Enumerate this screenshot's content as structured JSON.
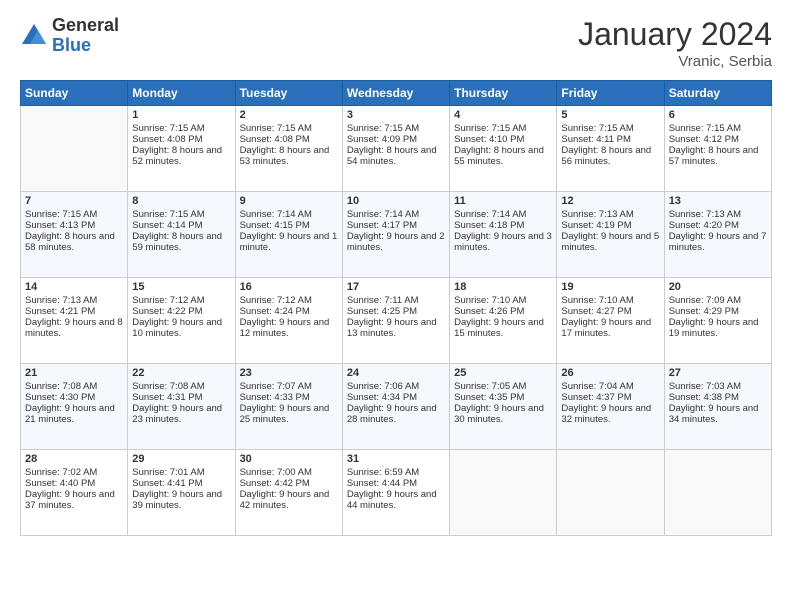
{
  "logo": {
    "general": "General",
    "blue": "Blue"
  },
  "title": "January 2024",
  "location": "Vranic, Serbia",
  "days_header": [
    "Sunday",
    "Monday",
    "Tuesday",
    "Wednesday",
    "Thursday",
    "Friday",
    "Saturday"
  ],
  "weeks": [
    [
      {
        "day": "",
        "sunrise": "",
        "sunset": "",
        "daylight": ""
      },
      {
        "day": "1",
        "sunrise": "Sunrise: 7:15 AM",
        "sunset": "Sunset: 4:08 PM",
        "daylight": "Daylight: 8 hours and 52 minutes."
      },
      {
        "day": "2",
        "sunrise": "Sunrise: 7:15 AM",
        "sunset": "Sunset: 4:08 PM",
        "daylight": "Daylight: 8 hours and 53 minutes."
      },
      {
        "day": "3",
        "sunrise": "Sunrise: 7:15 AM",
        "sunset": "Sunset: 4:09 PM",
        "daylight": "Daylight: 8 hours and 54 minutes."
      },
      {
        "day": "4",
        "sunrise": "Sunrise: 7:15 AM",
        "sunset": "Sunset: 4:10 PM",
        "daylight": "Daylight: 8 hours and 55 minutes."
      },
      {
        "day": "5",
        "sunrise": "Sunrise: 7:15 AM",
        "sunset": "Sunset: 4:11 PM",
        "daylight": "Daylight: 8 hours and 56 minutes."
      },
      {
        "day": "6",
        "sunrise": "Sunrise: 7:15 AM",
        "sunset": "Sunset: 4:12 PM",
        "daylight": "Daylight: 8 hours and 57 minutes."
      }
    ],
    [
      {
        "day": "7",
        "sunrise": "Sunrise: 7:15 AM",
        "sunset": "Sunset: 4:13 PM",
        "daylight": "Daylight: 8 hours and 58 minutes."
      },
      {
        "day": "8",
        "sunrise": "Sunrise: 7:15 AM",
        "sunset": "Sunset: 4:14 PM",
        "daylight": "Daylight: 8 hours and 59 minutes."
      },
      {
        "day": "9",
        "sunrise": "Sunrise: 7:14 AM",
        "sunset": "Sunset: 4:15 PM",
        "daylight": "Daylight: 9 hours and 1 minute."
      },
      {
        "day": "10",
        "sunrise": "Sunrise: 7:14 AM",
        "sunset": "Sunset: 4:17 PM",
        "daylight": "Daylight: 9 hours and 2 minutes."
      },
      {
        "day": "11",
        "sunrise": "Sunrise: 7:14 AM",
        "sunset": "Sunset: 4:18 PM",
        "daylight": "Daylight: 9 hours and 3 minutes."
      },
      {
        "day": "12",
        "sunrise": "Sunrise: 7:13 AM",
        "sunset": "Sunset: 4:19 PM",
        "daylight": "Daylight: 9 hours and 5 minutes."
      },
      {
        "day": "13",
        "sunrise": "Sunrise: 7:13 AM",
        "sunset": "Sunset: 4:20 PM",
        "daylight": "Daylight: 9 hours and 7 minutes."
      }
    ],
    [
      {
        "day": "14",
        "sunrise": "Sunrise: 7:13 AM",
        "sunset": "Sunset: 4:21 PM",
        "daylight": "Daylight: 9 hours and 8 minutes."
      },
      {
        "day": "15",
        "sunrise": "Sunrise: 7:12 AM",
        "sunset": "Sunset: 4:22 PM",
        "daylight": "Daylight: 9 hours and 10 minutes."
      },
      {
        "day": "16",
        "sunrise": "Sunrise: 7:12 AM",
        "sunset": "Sunset: 4:24 PM",
        "daylight": "Daylight: 9 hours and 12 minutes."
      },
      {
        "day": "17",
        "sunrise": "Sunrise: 7:11 AM",
        "sunset": "Sunset: 4:25 PM",
        "daylight": "Daylight: 9 hours and 13 minutes."
      },
      {
        "day": "18",
        "sunrise": "Sunrise: 7:10 AM",
        "sunset": "Sunset: 4:26 PM",
        "daylight": "Daylight: 9 hours and 15 minutes."
      },
      {
        "day": "19",
        "sunrise": "Sunrise: 7:10 AM",
        "sunset": "Sunset: 4:27 PM",
        "daylight": "Daylight: 9 hours and 17 minutes."
      },
      {
        "day": "20",
        "sunrise": "Sunrise: 7:09 AM",
        "sunset": "Sunset: 4:29 PM",
        "daylight": "Daylight: 9 hours and 19 minutes."
      }
    ],
    [
      {
        "day": "21",
        "sunrise": "Sunrise: 7:08 AM",
        "sunset": "Sunset: 4:30 PM",
        "daylight": "Daylight: 9 hours and 21 minutes."
      },
      {
        "day": "22",
        "sunrise": "Sunrise: 7:08 AM",
        "sunset": "Sunset: 4:31 PM",
        "daylight": "Daylight: 9 hours and 23 minutes."
      },
      {
        "day": "23",
        "sunrise": "Sunrise: 7:07 AM",
        "sunset": "Sunset: 4:33 PM",
        "daylight": "Daylight: 9 hours and 25 minutes."
      },
      {
        "day": "24",
        "sunrise": "Sunrise: 7:06 AM",
        "sunset": "Sunset: 4:34 PM",
        "daylight": "Daylight: 9 hours and 28 minutes."
      },
      {
        "day": "25",
        "sunrise": "Sunrise: 7:05 AM",
        "sunset": "Sunset: 4:35 PM",
        "daylight": "Daylight: 9 hours and 30 minutes."
      },
      {
        "day": "26",
        "sunrise": "Sunrise: 7:04 AM",
        "sunset": "Sunset: 4:37 PM",
        "daylight": "Daylight: 9 hours and 32 minutes."
      },
      {
        "day": "27",
        "sunrise": "Sunrise: 7:03 AM",
        "sunset": "Sunset: 4:38 PM",
        "daylight": "Daylight: 9 hours and 34 minutes."
      }
    ],
    [
      {
        "day": "28",
        "sunrise": "Sunrise: 7:02 AM",
        "sunset": "Sunset: 4:40 PM",
        "daylight": "Daylight: 9 hours and 37 minutes."
      },
      {
        "day": "29",
        "sunrise": "Sunrise: 7:01 AM",
        "sunset": "Sunset: 4:41 PM",
        "daylight": "Daylight: 9 hours and 39 minutes."
      },
      {
        "day": "30",
        "sunrise": "Sunrise: 7:00 AM",
        "sunset": "Sunset: 4:42 PM",
        "daylight": "Daylight: 9 hours and 42 minutes."
      },
      {
        "day": "31",
        "sunrise": "Sunrise: 6:59 AM",
        "sunset": "Sunset: 4:44 PM",
        "daylight": "Daylight: 9 hours and 44 minutes."
      },
      {
        "day": "",
        "sunrise": "",
        "sunset": "",
        "daylight": ""
      },
      {
        "day": "",
        "sunrise": "",
        "sunset": "",
        "daylight": ""
      },
      {
        "day": "",
        "sunrise": "",
        "sunset": "",
        "daylight": ""
      }
    ]
  ]
}
